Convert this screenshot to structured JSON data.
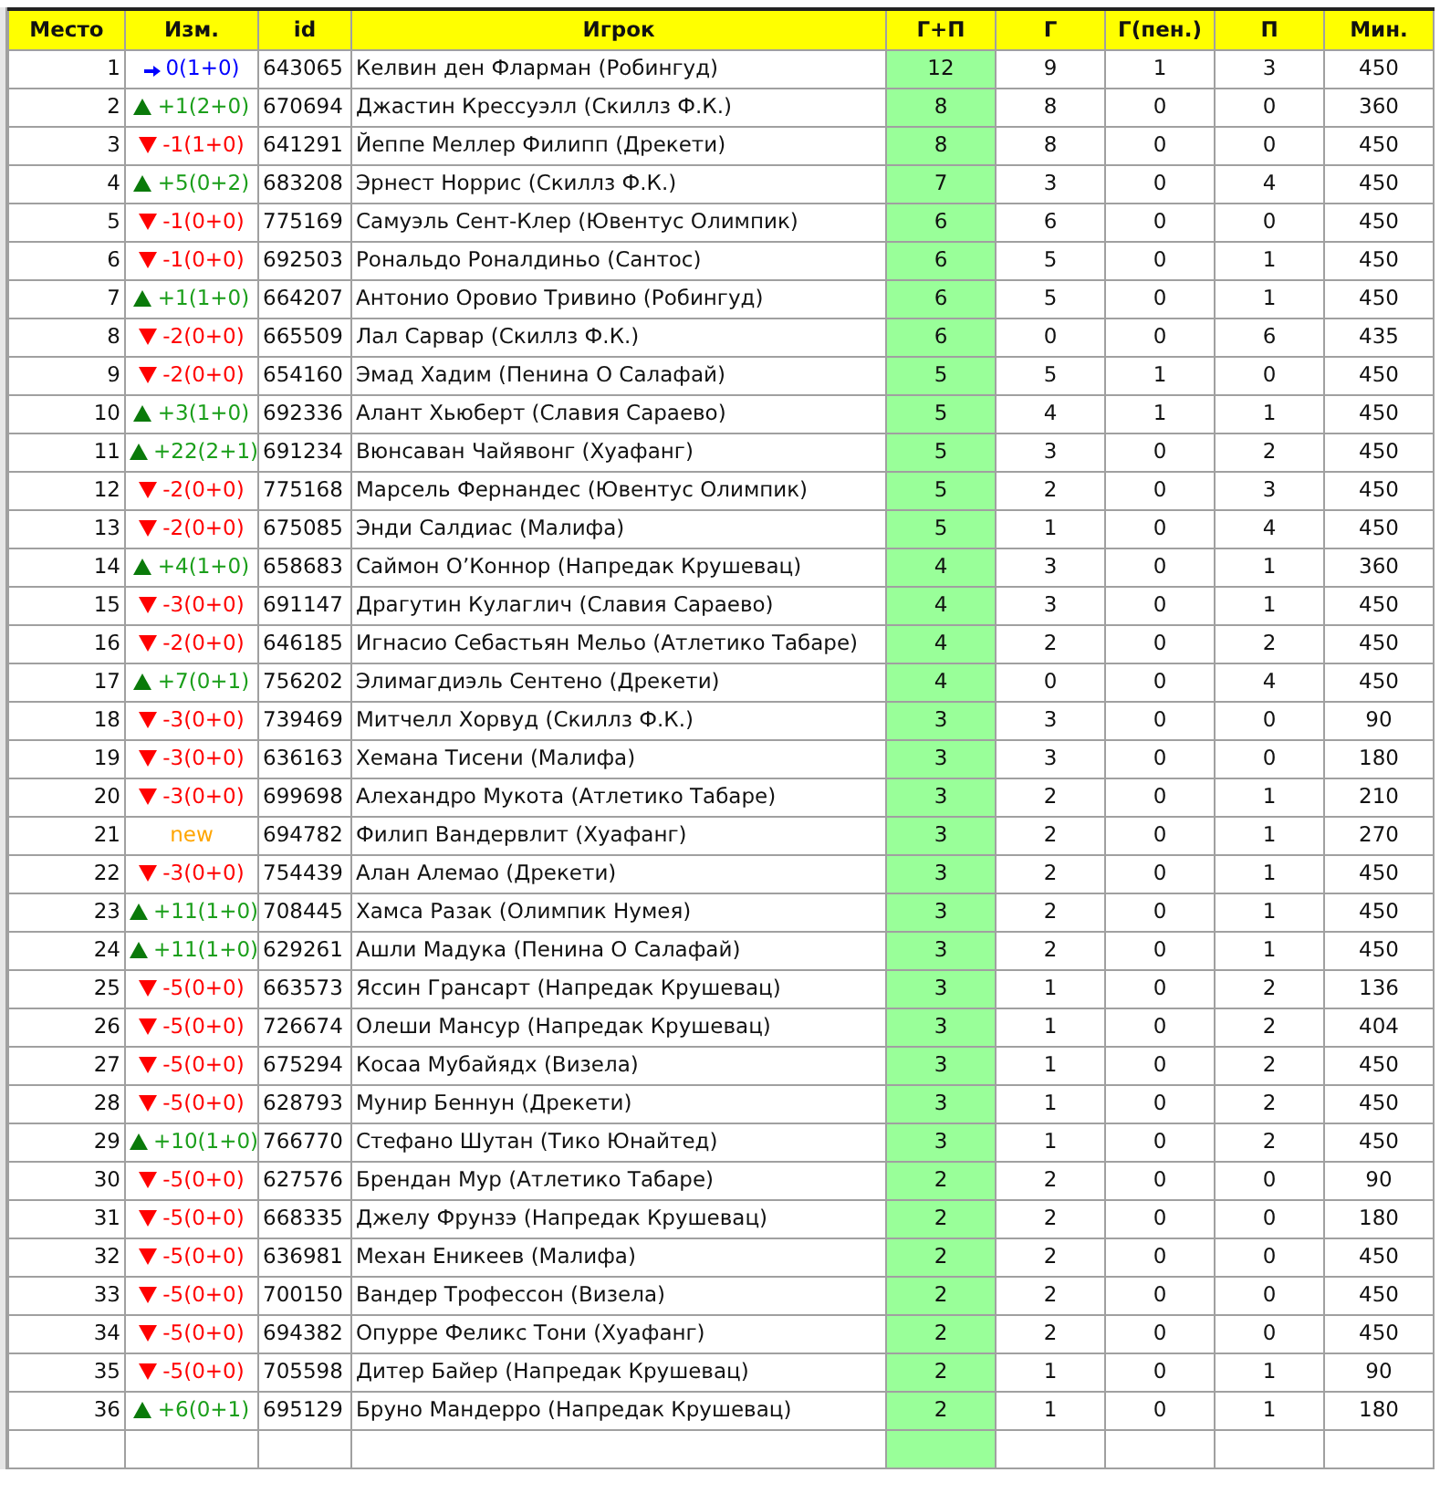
{
  "columns": [
    "Место",
    "Изм.",
    "id",
    "Игрок",
    "Г+П",
    "Г",
    "Г(пен.)",
    "П",
    "Мин."
  ],
  "rows": [
    {
      "place": "1",
      "kind": "same",
      "change": "0(1+0)",
      "id": "643065",
      "player": "Келвин ден Фларман (Робингуд)",
      "gp": "12",
      "g": "9",
      "g_pen": "1",
      "p": "3",
      "min": "450"
    },
    {
      "place": "2",
      "kind": "up",
      "change": "+1(2+0)",
      "id": "670694",
      "player": "Джастин Крессуэлл (Скиллз Ф.К.)",
      "gp": "8",
      "g": "8",
      "g_pen": "0",
      "p": "0",
      "min": "360"
    },
    {
      "place": "3",
      "kind": "down",
      "change": "-1(1+0)",
      "id": "641291",
      "player": "Йеппе Меллер Филипп (Дрекети)",
      "gp": "8",
      "g": "8",
      "g_pen": "0",
      "p": "0",
      "min": "450"
    },
    {
      "place": "4",
      "kind": "up",
      "change": "+5(0+2)",
      "id": "683208",
      "player": "Эрнест Норрис (Скиллз Ф.К.)",
      "gp": "7",
      "g": "3",
      "g_pen": "0",
      "p": "4",
      "min": "450"
    },
    {
      "place": "5",
      "kind": "down",
      "change": "-1(0+0)",
      "id": "775169",
      "player": "Самуэль Сент-Клер (Ювентус Олимпик)",
      "gp": "6",
      "g": "6",
      "g_pen": "0",
      "p": "0",
      "min": "450"
    },
    {
      "place": "6",
      "kind": "down",
      "change": "-1(0+0)",
      "id": "692503",
      "player": "Рональдо Роналдиньо (Сантос)",
      "gp": "6",
      "g": "5",
      "g_pen": "0",
      "p": "1",
      "min": "450"
    },
    {
      "place": "7",
      "kind": "up",
      "change": "+1(1+0)",
      "id": "664207",
      "player": "Антонио Оровио Тривино (Робингуд)",
      "gp": "6",
      "g": "5",
      "g_pen": "0",
      "p": "1",
      "min": "450"
    },
    {
      "place": "8",
      "kind": "down",
      "change": "-2(0+0)",
      "id": "665509",
      "player": "Лал Сарвар (Скиллз Ф.К.)",
      "gp": "6",
      "g": "0",
      "g_pen": "0",
      "p": "6",
      "min": "435"
    },
    {
      "place": "9",
      "kind": "down",
      "change": "-2(0+0)",
      "id": "654160",
      "player": "Эмад Хадим (Пенина О Салафай)",
      "gp": "5",
      "g": "5",
      "g_pen": "1",
      "p": "0",
      "min": "450"
    },
    {
      "place": "10",
      "kind": "up",
      "change": "+3(1+0)",
      "id": "692336",
      "player": "Алант Хьюберт (Славия Сараево)",
      "gp": "5",
      "g": "4",
      "g_pen": "1",
      "p": "1",
      "min": "450"
    },
    {
      "place": "11",
      "kind": "up",
      "change": "+22(2+1)",
      "id": "691234",
      "player": "Вюнсаван Чайявонг (Хуафанг)",
      "gp": "5",
      "g": "3",
      "g_pen": "0",
      "p": "2",
      "min": "450"
    },
    {
      "place": "12",
      "kind": "down",
      "change": "-2(0+0)",
      "id": "775168",
      "player": "Марсель Фернандес (Ювентус Олимпик)",
      "gp": "5",
      "g": "2",
      "g_pen": "0",
      "p": "3",
      "min": "450"
    },
    {
      "place": "13",
      "kind": "down",
      "change": "-2(0+0)",
      "id": "675085",
      "player": "Энди Салдиас (Малифа)",
      "gp": "5",
      "g": "1",
      "g_pen": "0",
      "p": "4",
      "min": "450"
    },
    {
      "place": "14",
      "kind": "up",
      "change": "+4(1+0)",
      "id": "658683",
      "player": "Саймон О’Коннор (Напредак Крушевац)",
      "gp": "4",
      "g": "3",
      "g_pen": "0",
      "p": "1",
      "min": "360"
    },
    {
      "place": "15",
      "kind": "down",
      "change": "-3(0+0)",
      "id": "691147",
      "player": "Драгутин Кулаглич (Славия Сараево)",
      "gp": "4",
      "g": "3",
      "g_pen": "0",
      "p": "1",
      "min": "450"
    },
    {
      "place": "16",
      "kind": "down",
      "change": "-2(0+0)",
      "id": "646185",
      "player": "Игнасио Себастьян Мельо (Атлетико Табаре)",
      "gp": "4",
      "g": "2",
      "g_pen": "0",
      "p": "2",
      "min": "450"
    },
    {
      "place": "17",
      "kind": "up",
      "change": "+7(0+1)",
      "id": "756202",
      "player": "Элимагдиэль Сентено (Дрекети)",
      "gp": "4",
      "g": "0",
      "g_pen": "0",
      "p": "4",
      "min": "450"
    },
    {
      "place": "18",
      "kind": "down",
      "change": "-3(0+0)",
      "id": "739469",
      "player": "Митчелл Хорвуд (Скиллз Ф.К.)",
      "gp": "3",
      "g": "3",
      "g_pen": "0",
      "p": "0",
      "min": "90"
    },
    {
      "place": "19",
      "kind": "down",
      "change": "-3(0+0)",
      "id": "636163",
      "player": "Хемана Тисени (Малифа)",
      "gp": "3",
      "g": "3",
      "g_pen": "0",
      "p": "0",
      "min": "180"
    },
    {
      "place": "20",
      "kind": "down",
      "change": "-3(0+0)",
      "id": "699698",
      "player": "Алехандро Мукота (Атлетико Табаре)",
      "gp": "3",
      "g": "2",
      "g_pen": "0",
      "p": "1",
      "min": "210"
    },
    {
      "place": "21",
      "kind": "new",
      "change": "new",
      "id": "694782",
      "player": "Филип Вандервлит (Хуафанг)",
      "gp": "3",
      "g": "2",
      "g_pen": "0",
      "p": "1",
      "min": "270"
    },
    {
      "place": "22",
      "kind": "down",
      "change": "-3(0+0)",
      "id": "754439",
      "player": "Алан Алемао (Дрекети)",
      "gp": "3",
      "g": "2",
      "g_pen": "0",
      "p": "1",
      "min": "450"
    },
    {
      "place": "23",
      "kind": "up",
      "change": "+11(1+0)",
      "id": "708445",
      "player": "Хамса Разак (Олимпик Нумея)",
      "gp": "3",
      "g": "2",
      "g_pen": "0",
      "p": "1",
      "min": "450"
    },
    {
      "place": "24",
      "kind": "up",
      "change": "+11(1+0)",
      "id": "629261",
      "player": "Ашли Мадука (Пенина О Салафай)",
      "gp": "3",
      "g": "2",
      "g_pen": "0",
      "p": "1",
      "min": "450"
    },
    {
      "place": "25",
      "kind": "down",
      "change": "-5(0+0)",
      "id": "663573",
      "player": "Яссин Грансарт (Напредак Крушевац)",
      "gp": "3",
      "g": "1",
      "g_pen": "0",
      "p": "2",
      "min": "136"
    },
    {
      "place": "26",
      "kind": "down",
      "change": "-5(0+0)",
      "id": "726674",
      "player": "Олеши Мансур (Напредак Крушевац)",
      "gp": "3",
      "g": "1",
      "g_pen": "0",
      "p": "2",
      "min": "404"
    },
    {
      "place": "27",
      "kind": "down",
      "change": "-5(0+0)",
      "id": "675294",
      "player": "Косаа Мубайядх (Визела)",
      "gp": "3",
      "g": "1",
      "g_pen": "0",
      "p": "2",
      "min": "450"
    },
    {
      "place": "28",
      "kind": "down",
      "change": "-5(0+0)",
      "id": "628793",
      "player": "Мунир Беннун (Дрекети)",
      "gp": "3",
      "g": "1",
      "g_pen": "0",
      "p": "2",
      "min": "450"
    },
    {
      "place": "29",
      "kind": "up",
      "change": "+10(1+0)",
      "id": "766770",
      "player": "Стефано Шутан (Тико Юнайтед)",
      "gp": "3",
      "g": "1",
      "g_pen": "0",
      "p": "2",
      "min": "450"
    },
    {
      "place": "30",
      "kind": "down",
      "change": "-5(0+0)",
      "id": "627576",
      "player": "Брендан Мур (Атлетико Табаре)",
      "gp": "2",
      "g": "2",
      "g_pen": "0",
      "p": "0",
      "min": "90"
    },
    {
      "place": "31",
      "kind": "down",
      "change": "-5(0+0)",
      "id": "668335",
      "player": "Джелу Фрунзэ (Напредак Крушевац)",
      "gp": "2",
      "g": "2",
      "g_pen": "0",
      "p": "0",
      "min": "180"
    },
    {
      "place": "32",
      "kind": "down",
      "change": "-5(0+0)",
      "id": "636981",
      "player": "Механ Еникеев (Малифа)",
      "gp": "2",
      "g": "2",
      "g_pen": "0",
      "p": "0",
      "min": "450"
    },
    {
      "place": "33",
      "kind": "down",
      "change": "-5(0+0)",
      "id": "700150",
      "player": "Вандер Трофессон (Визела)",
      "gp": "2",
      "g": "2",
      "g_pen": "0",
      "p": "0",
      "min": "450"
    },
    {
      "place": "34",
      "kind": "down",
      "change": "-5(0+0)",
      "id": "694382",
      "player": "Опурре Феликс Тони (Хуафанг)",
      "gp": "2",
      "g": "2",
      "g_pen": "0",
      "p": "0",
      "min": "450"
    },
    {
      "place": "35",
      "kind": "down",
      "change": "-5(0+0)",
      "id": "705598",
      "player": "Дитер Байер (Напредак Крушевац)",
      "gp": "2",
      "g": "1",
      "g_pen": "0",
      "p": "1",
      "min": "90"
    },
    {
      "place": "36",
      "kind": "up",
      "change": "+6(0+1)",
      "id": "695129",
      "player": "Бруно Мандерро (Напредак Крушевац)",
      "gp": "2",
      "g": "1",
      "g_pen": "0",
      "p": "1",
      "min": "180"
    }
  ]
}
